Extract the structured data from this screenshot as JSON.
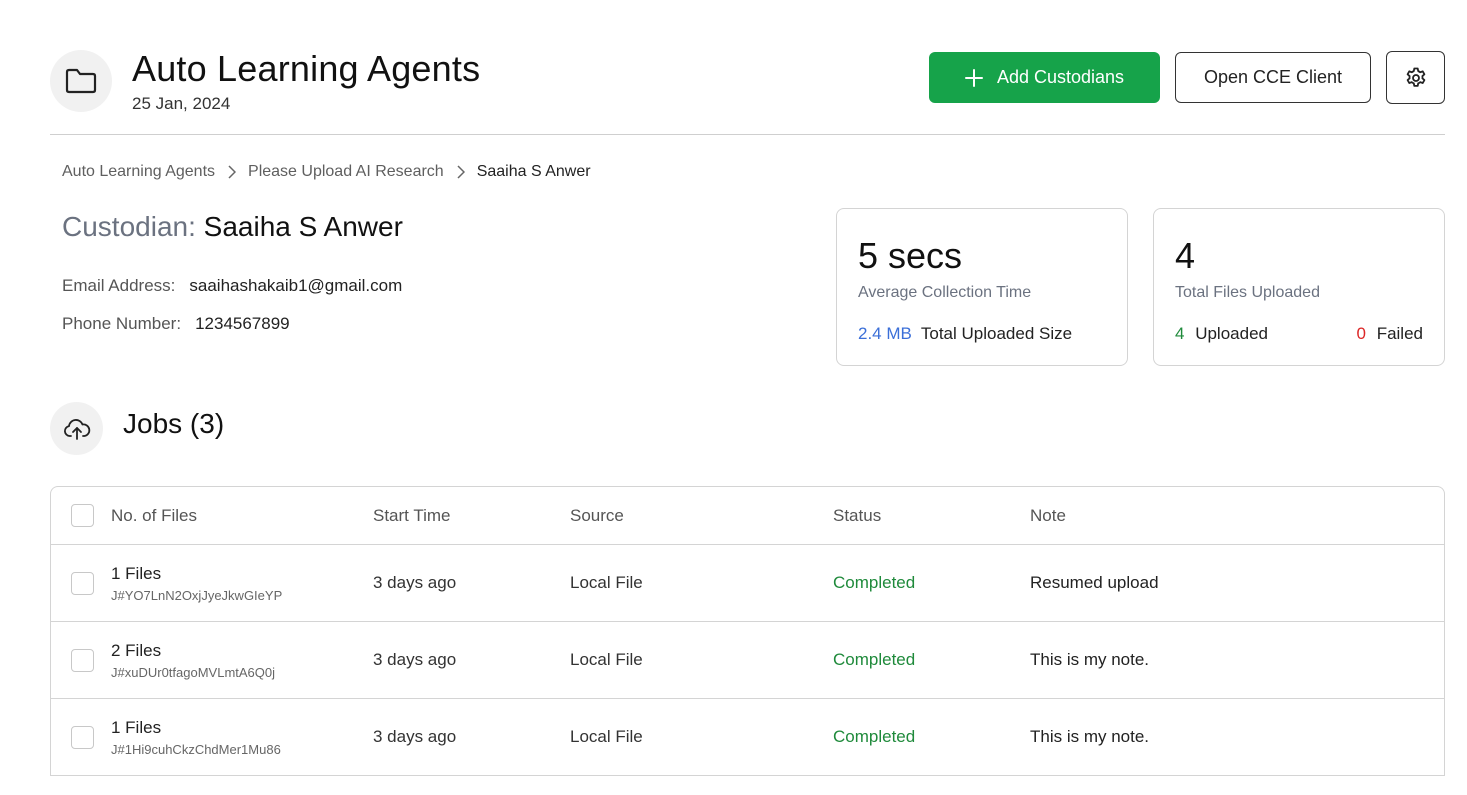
{
  "header": {
    "title": "Auto Learning Agents",
    "date": "25 Jan, 2024",
    "add_button": "Add Custodians",
    "cce_button": "Open CCE Client"
  },
  "breadcrumb": [
    "Auto Learning Agents",
    "Please Upload AI Research",
    "Saaiha S Anwer"
  ],
  "custodian": {
    "label": "Custodian:",
    "name": "Saaiha S Anwer",
    "email_label": "Email Address:",
    "email": "saaihashakaib1@gmail.com",
    "phone_label": "Phone Number:",
    "phone": "1234567899"
  },
  "stats": {
    "collection": {
      "value": "5 secs",
      "label": "Average Collection Time",
      "size_value": "2.4 MB",
      "size_label": "Total Uploaded Size"
    },
    "files": {
      "value": "4",
      "label": "Total Files Uploaded",
      "uploaded_count": "4",
      "uploaded_label": "Uploaded",
      "failed_count": "0",
      "failed_label": "Failed"
    }
  },
  "jobs": {
    "title": "Jobs (3)",
    "columns": [
      "No. of Files",
      "Start Time",
      "Source",
      "Status",
      "Note"
    ],
    "rows": [
      {
        "files": "1 Files",
        "id": "J#YO7LnN2OxjJyeJkwGIeYP",
        "start": "3 days ago",
        "source": "Local File",
        "status": "Completed",
        "note": "Resumed upload"
      },
      {
        "files": "2 Files",
        "id": "J#xuDUr0tfagoMVLmtA6Q0j",
        "start": "3 days ago",
        "source": "Local File",
        "status": "Completed",
        "note": "This is my note."
      },
      {
        "files": "1 Files",
        "id": "J#1Hi9cuhCkzChdMer1Mu86",
        "start": "3 days ago",
        "source": "Local File",
        "status": "Completed",
        "note": "This is my note."
      }
    ]
  },
  "colors": {
    "accent_green": "#16a34a",
    "status_green": "#1f8a3b",
    "size_blue": "#3b6fd8",
    "failed_red": "#dc2626"
  },
  "icons": {
    "folder": "folder-icon",
    "plus": "plus-icon",
    "gear": "gear-icon",
    "chevron": "chevron-right-icon",
    "upload": "cloud-upload-icon"
  }
}
